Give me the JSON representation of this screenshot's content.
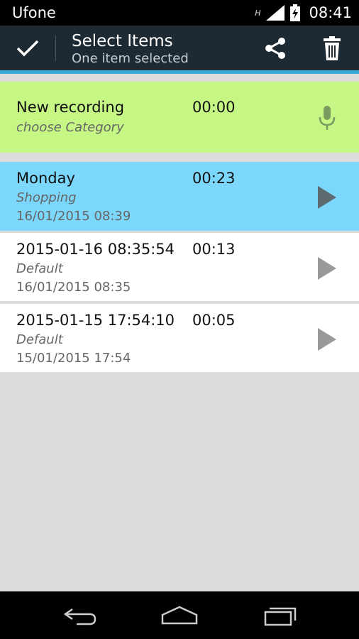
{
  "status_bar": {
    "carrier": "Ufone",
    "network_type": "H",
    "time": "08:41"
  },
  "action_bar": {
    "title": "Select Items",
    "subtitle": "One item selected",
    "icons": [
      "check-icon",
      "share-icon",
      "trash-icon"
    ]
  },
  "new_recording": {
    "name": "New recording",
    "duration": "00:00",
    "category": "choose Category",
    "icon": "microphone-icon"
  },
  "recordings": [
    {
      "name": "Monday",
      "duration": "00:23",
      "category": "Shopping",
      "date": "16/01/2015 08:39",
      "selected": true
    },
    {
      "name": "2015-01-16 08:35:54",
      "duration": "00:13",
      "category": "Default",
      "date": "16/01/2015 08:35",
      "selected": false
    },
    {
      "name": "2015-01-15 17:54:10",
      "duration": "00:05",
      "category": "Default",
      "date": "15/01/2015 17:54",
      "selected": false
    }
  ],
  "colors": {
    "action_bar_bg": "#1d2a33",
    "accent_line": "#3aa9d9",
    "new_recording_bg": "#c6f684",
    "selected_row_bg": "#7bd7fc",
    "list_bg": "#dcdcdc"
  },
  "nav_bar": {
    "icons": [
      "back-icon",
      "home-icon",
      "recents-icon"
    ]
  }
}
